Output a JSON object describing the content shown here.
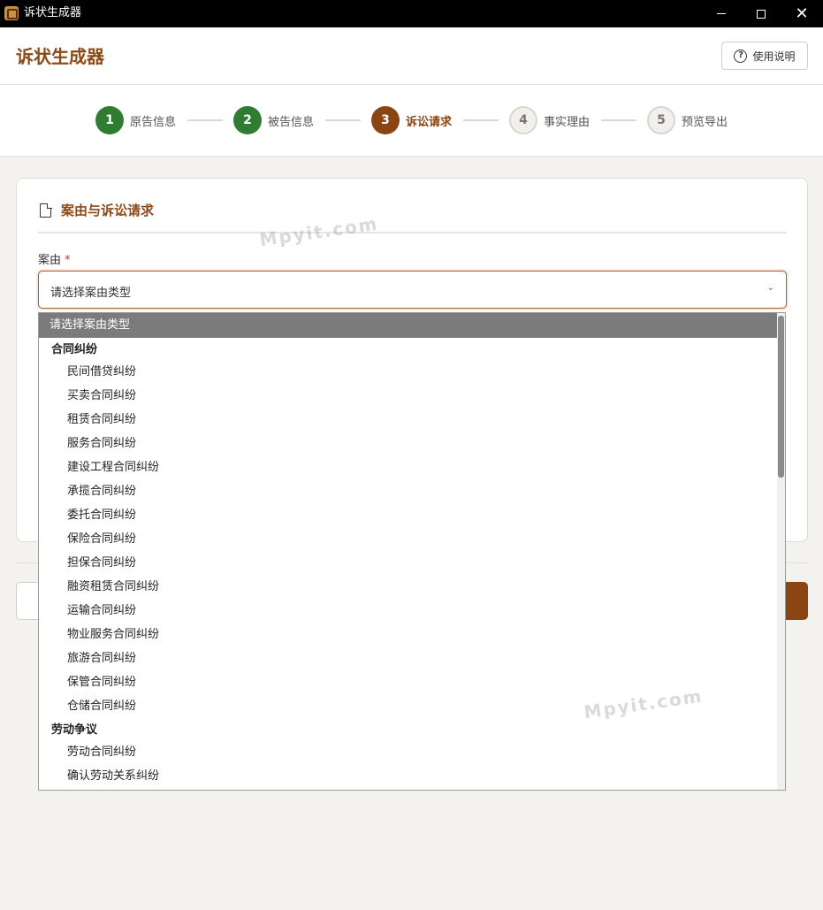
{
  "window": {
    "title": "诉状生成器"
  },
  "header": {
    "title": "诉状生成器",
    "help_label": "使用说明"
  },
  "steps": [
    {
      "num": "1",
      "label": "原告信息",
      "state": "done"
    },
    {
      "num": "2",
      "label": "被告信息",
      "state": "done"
    },
    {
      "num": "3",
      "label": "诉讼请求",
      "state": "active"
    },
    {
      "num": "4",
      "label": "事实理由",
      "state": "todo"
    },
    {
      "num": "5",
      "label": "预览导出",
      "state": "todo"
    }
  ],
  "card": {
    "title": "案由与诉讼请求",
    "field_label": "案由",
    "required_mark": "*",
    "select_value": "请选择案由类型"
  },
  "dropdown": {
    "selected": "请选择案由类型",
    "groups": [
      {
        "label": "合同纠纷",
        "items": [
          "民间借贷纠纷",
          "买卖合同纠纷",
          "租赁合同纠纷",
          "服务合同纠纷",
          "建设工程合同纠纷",
          "承揽合同纠纷",
          "委托合同纠纷",
          "保险合同纠纷",
          "担保合同纠纷",
          "融资租赁合同纠纷",
          "运输合同纠纷",
          "物业服务合同纠纷",
          "旅游合同纠纷",
          "保管合同纠纷",
          "仓储合同纠纷"
        ]
      },
      {
        "label": "劳动争议",
        "items": [
          "劳动合同纠纷",
          "确认劳动关系纠纷"
        ]
      }
    ]
  },
  "watermarks": [
    "Mpyit.com",
    "Mpyit.com"
  ],
  "colors": {
    "accent": "#8b4513",
    "done": "#2f7d32",
    "title": "#8b4a18"
  }
}
